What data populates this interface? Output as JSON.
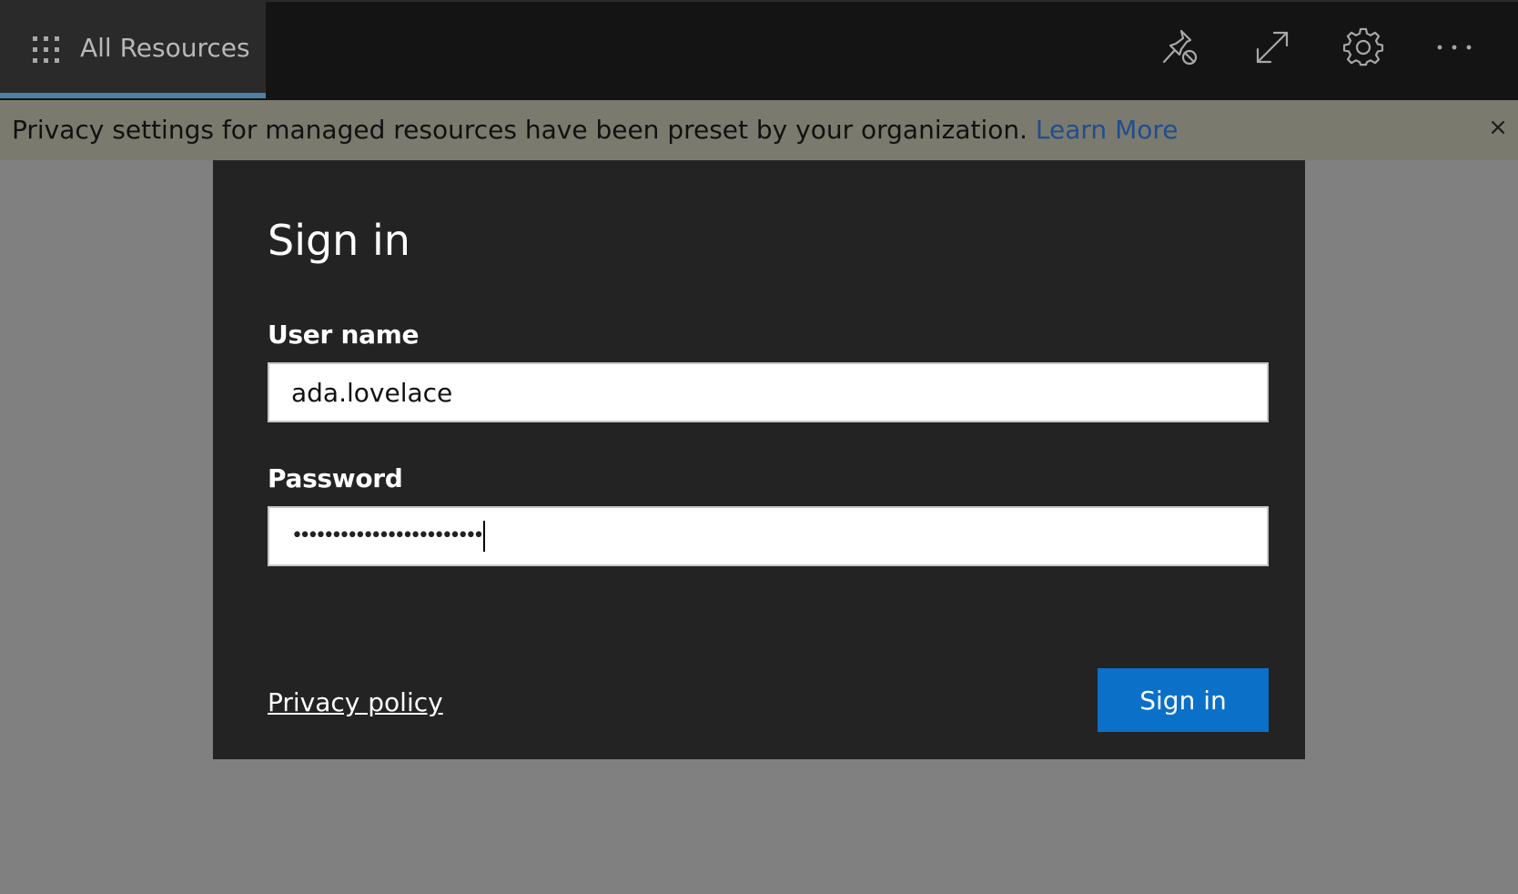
{
  "topbar": {
    "app_title": "All Resources",
    "icons": [
      "unpin-icon",
      "expand-icon",
      "gear-icon",
      "more-icon"
    ]
  },
  "banner": {
    "message": "Privacy settings for managed resources have been preset by your organization.",
    "link_label": "Learn More",
    "close_glyph": "×"
  },
  "dialog": {
    "title": "Sign in",
    "username_label": "User name",
    "username_value": "ada.lovelace",
    "password_label": "Password",
    "password_masked": "••••••••••••••••••••••••",
    "privacy_link": "Privacy policy",
    "submit_label": "Sign in"
  },
  "colors": {
    "accent": "#0a70c8",
    "link": "#1f4e8f",
    "banner_bg": "#7b7a6e",
    "dialog_bg": "#232323",
    "overlay_bg": "#808080"
  }
}
